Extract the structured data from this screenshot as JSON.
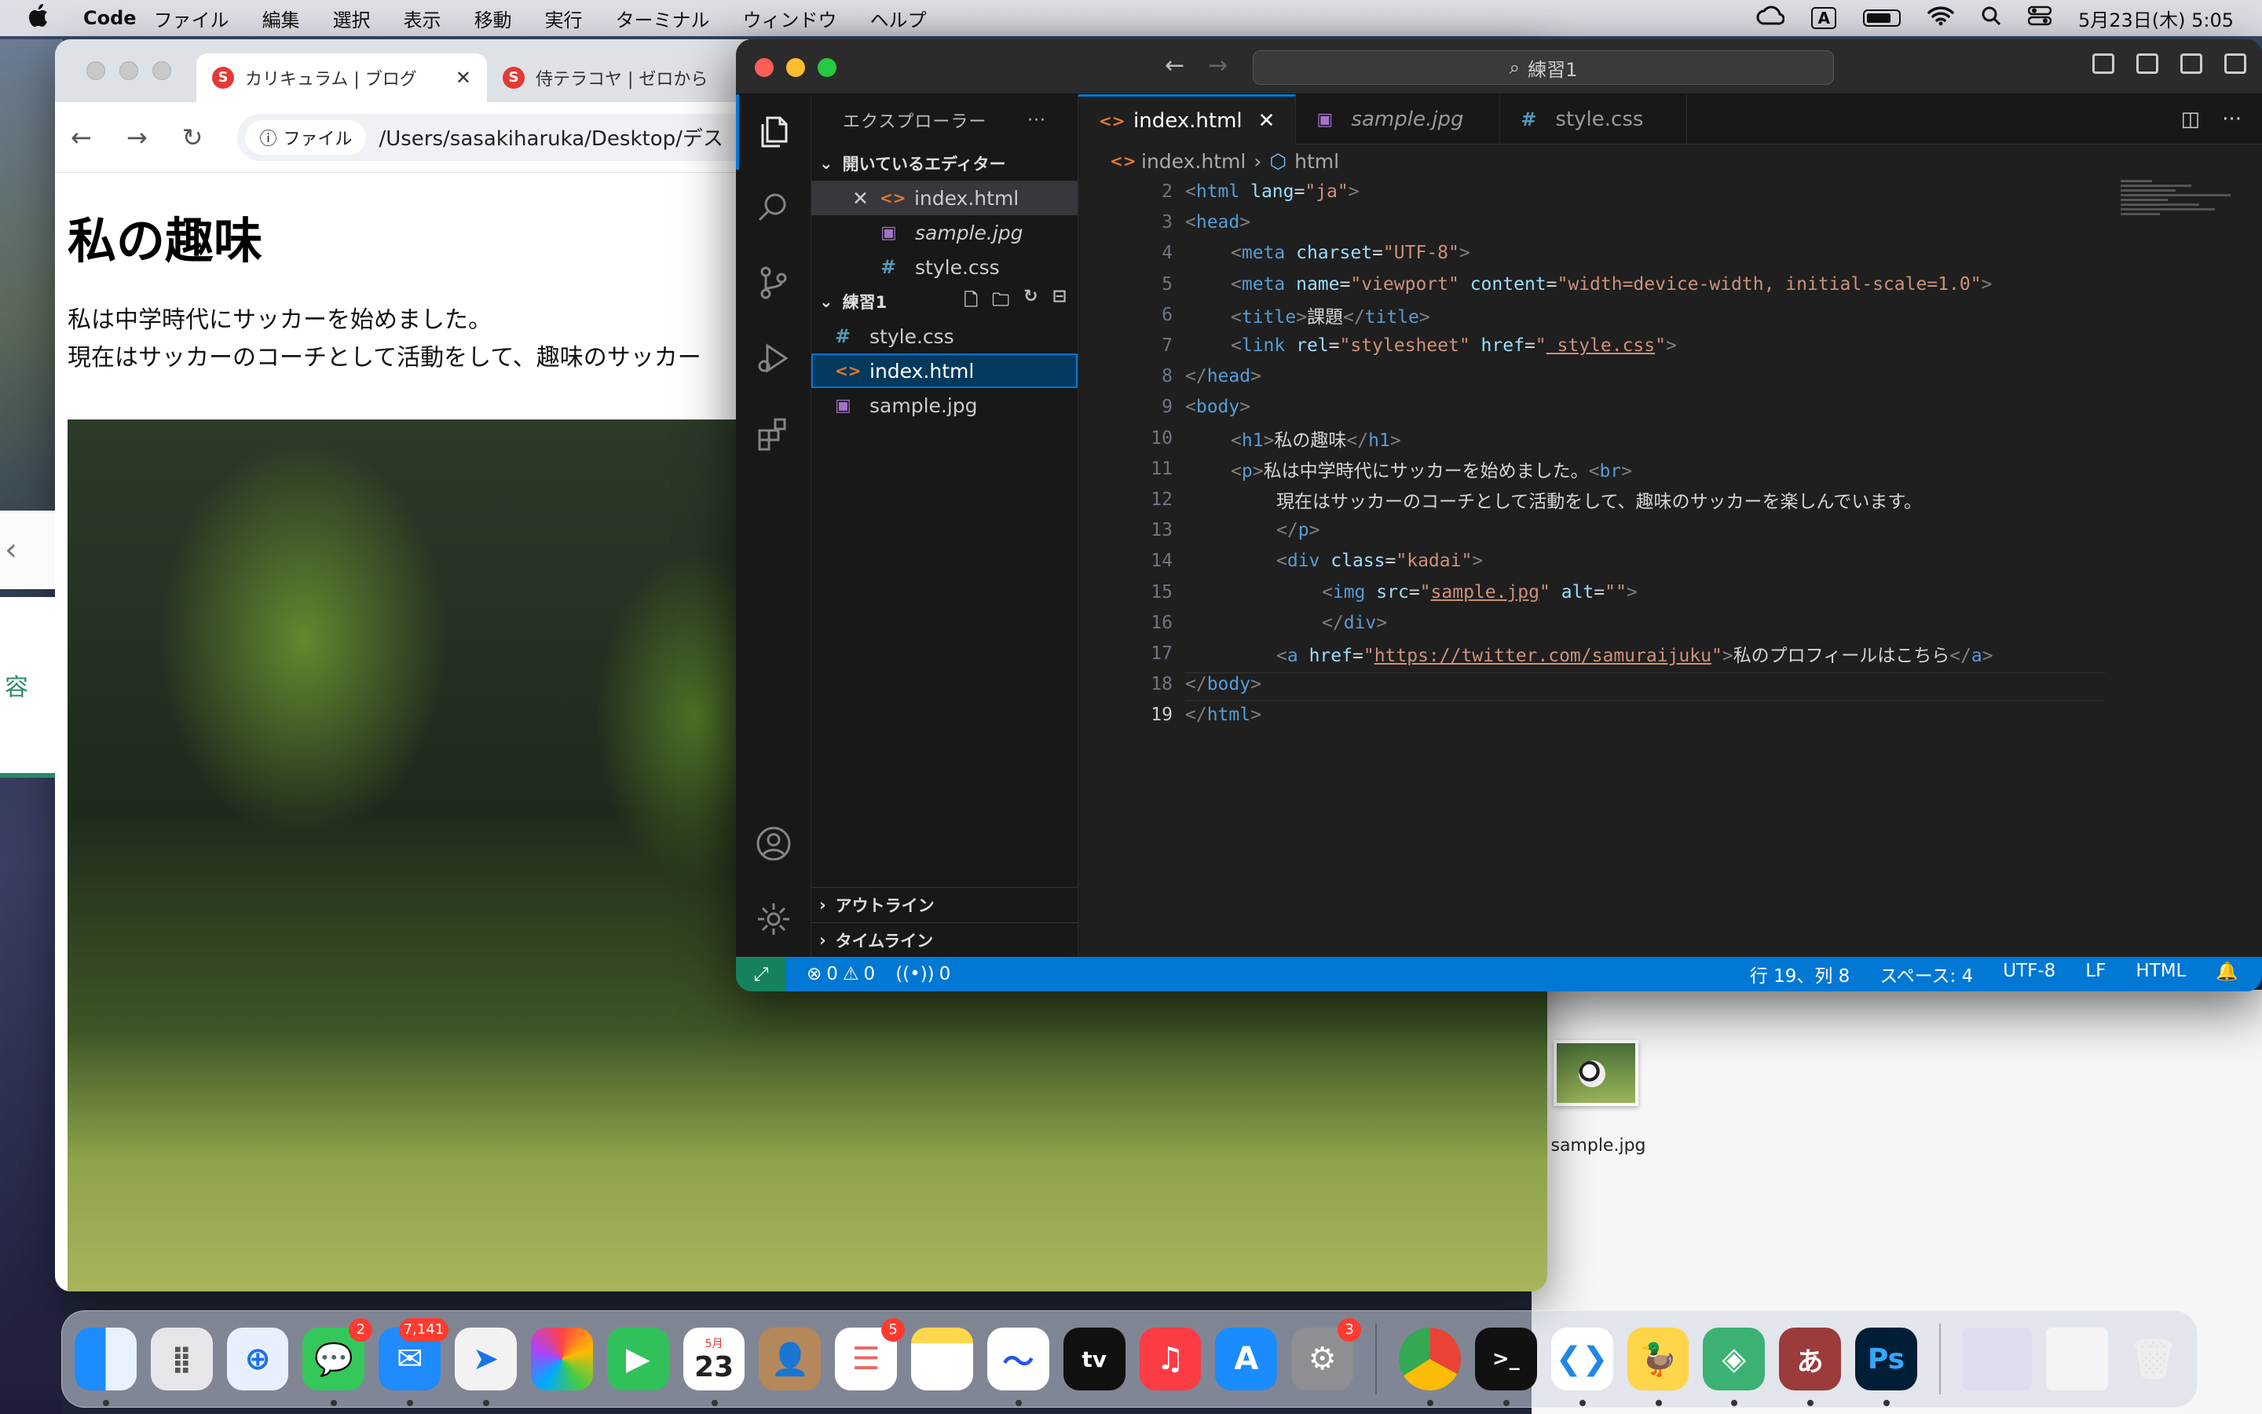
{
  "menubar": {
    "app": "Code",
    "items": [
      "ファイル",
      "編集",
      "選択",
      "表示",
      "移動",
      "実行",
      "ターミナル",
      "ウィンドウ",
      "ヘルプ"
    ],
    "ime": "A",
    "datetime": "5月23日(木) 5:05"
  },
  "browser": {
    "tabs": [
      {
        "title": "カリキュラム | ブログ"
      },
      {
        "title": "侍テラコヤ | ゼロから"
      }
    ],
    "address_chip": "ファイル",
    "address": "/Users/sasakiharuka/Desktop/デス",
    "page": {
      "h1": "私の趣味",
      "p_line1": "私は中学時代にサッカーを始めました。",
      "p_line2": "現在はサッカーのコーチとして活動をして、趣味のサッカー"
    },
    "side_peek_text": "容"
  },
  "vscode": {
    "command_center": "練習1",
    "sidebar": {
      "title": "エクスプローラー",
      "open_editors_title": "開いているエディター",
      "open_editors": [
        "index.html",
        "sample.jpg",
        "style.css"
      ],
      "folder_title": "練習1",
      "files": [
        "style.css",
        "index.html",
        "sample.jpg"
      ],
      "outline": "アウトライン",
      "timeline": "タイムライン"
    },
    "tabs": [
      {
        "label": "index.html",
        "active": true
      },
      {
        "label": "sample.jpg",
        "active": false
      },
      {
        "label": "style.css",
        "active": false
      }
    ],
    "breadcrumb": {
      "file": "index.html",
      "symbol": "html"
    },
    "line_numbers": [
      "2",
      "3",
      "4",
      "5",
      "6",
      "7",
      "8",
      "9",
      "10",
      "11",
      "12",
      "13",
      "14",
      "15",
      "16",
      "17",
      "18",
      "19"
    ],
    "code": {
      "l2": [
        "<",
        "html",
        " ",
        "lang",
        "=",
        "\"ja\"",
        ">"
      ],
      "l3": [
        "<",
        "head",
        ">"
      ],
      "l4": [
        "<",
        "meta",
        " ",
        "charset",
        "=",
        "\"UTF-8\"",
        ">"
      ],
      "l5": [
        "<",
        "meta",
        " ",
        "name",
        "=",
        "\"viewport\"",
        " ",
        "content",
        "=",
        "\"width=device-width, initial-scale=1.0\"",
        ">"
      ],
      "l6": [
        "<",
        "title",
        ">",
        "課題",
        "</",
        "title",
        ">"
      ],
      "l7": [
        "<",
        "link",
        " ",
        "rel",
        "=",
        "\"stylesheet\"",
        " ",
        "href",
        "=",
        "\"",
        "_style.css",
        "\"",
        ">"
      ],
      "l8": [
        "</",
        "head",
        ">"
      ],
      "l9": [
        "<",
        "body",
        ">"
      ],
      "l10": [
        "<",
        "h1",
        ">",
        "私の趣味",
        "</",
        "h1",
        ">"
      ],
      "l11": [
        "<",
        "p",
        ">",
        "私は中学時代にサッカーを始めました。",
        "<",
        "br",
        ">"
      ],
      "l12": [
        "現在はサッカーのコーチとして活動をして、趣味のサッカーを楽しんでいます。"
      ],
      "l13": [
        "</",
        "p",
        ">"
      ],
      "l14": [
        "<",
        "div",
        " ",
        "class",
        "=",
        "\"kadai\"",
        ">"
      ],
      "l15": [
        "<",
        "img",
        " ",
        "src",
        "=",
        "\"",
        "sample.jpg",
        "\"",
        " ",
        "alt",
        "=",
        "\"\"",
        ">"
      ],
      "l16": [
        "</",
        "div",
        ">"
      ],
      "l17": [
        "<",
        "a",
        " ",
        "href",
        "=",
        "\"",
        "https://twitter.com/samuraijuku",
        "\"",
        ">",
        "私のプロフィールはこちら",
        "</",
        "a",
        ">"
      ],
      "l18": [
        "</",
        "body",
        ">"
      ],
      "l19": [
        "</",
        "html",
        ">"
      ]
    },
    "status": {
      "errors": "0",
      "warnings": "0",
      "ports": "0",
      "position": "行 19、列 8",
      "spaces": "スペース: 4",
      "encoding": "UTF-8",
      "eol": "LF",
      "language": "HTML"
    }
  },
  "desktop": {
    "file_label": "sample.jpg"
  },
  "dock": {
    "badges": {
      "messages": "2",
      "mail": "7,141",
      "reminders": "5",
      "settings": "3"
    },
    "calendar_month": "5月",
    "calendar_day": "23",
    "tv_label": "tv",
    "ps_label": "Ps",
    "ime_label": "あ"
  },
  "colors": {
    "vscode_accent": "#0078d4",
    "status_remote": "#16825d",
    "html_icon": "#e37933",
    "css_icon": "#519aba"
  }
}
